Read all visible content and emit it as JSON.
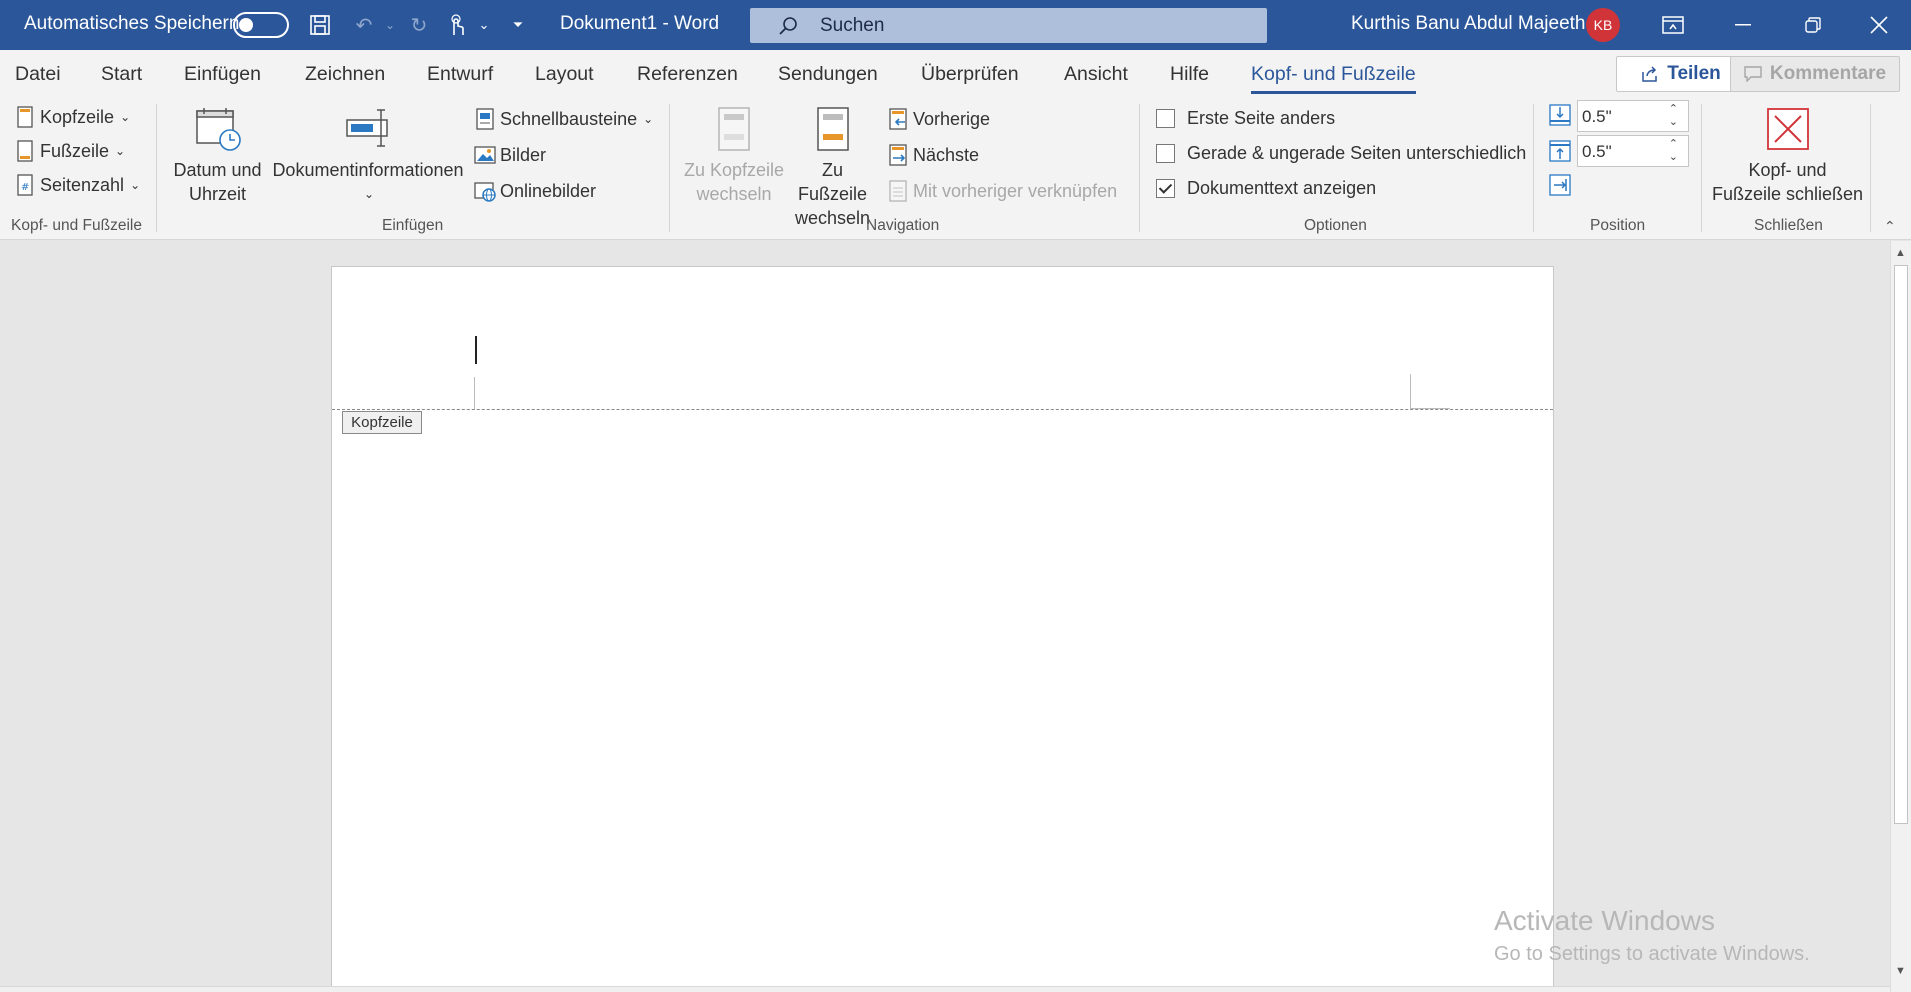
{
  "titlebar": {
    "autosave_label": "Automatisches Speichern",
    "doc_title": "Dokument1  -  Word",
    "search_placeholder": "Suchen",
    "user_name": "Kurthis Banu Abdul Majeeth",
    "user_initials": "KB"
  },
  "tabs": [
    "Datei",
    "Start",
    "Einfügen",
    "Zeichnen",
    "Entwurf",
    "Layout",
    "Referenzen",
    "Sendungen",
    "Überprüfen",
    "Ansicht",
    "Hilfe",
    "Kopf- und Fußzeile"
  ],
  "active_tab": "Kopf- und Fußzeile",
  "share_label": "Teilen",
  "comments_label": "Kommentare",
  "ribbon": {
    "group_kopf": {
      "label": "Kopf- und Fußzeile",
      "kopfzeile": "Kopfzeile",
      "fusszeile": "Fußzeile",
      "seitenzahl": "Seitenzahl"
    },
    "group_einfuegen": {
      "label": "Einfügen",
      "datum_line1": "Datum und",
      "datum_line2": "Uhrzeit",
      "dokinfo": "Dokumentinformationen",
      "schnellbausteine": "Schnellbausteine",
      "bilder": "Bilder",
      "onlinebilder": "Onlinebilder"
    },
    "group_navigation": {
      "label": "Navigation",
      "zu_kopf_line1": "Zu Kopfzeile",
      "zu_kopf_line2": "wechseln",
      "zu_fuss_line1": "Zu Fußzeile",
      "zu_fuss_line2": "wechseln",
      "vorherige": "Vorherige",
      "naechste": "Nächste",
      "verknuepfen": "Mit vorheriger verknüpfen"
    },
    "group_optionen": {
      "label": "Optionen",
      "erste_seite": "Erste Seite anders",
      "erste_seite_checked": false,
      "gerade_ungerade": "Gerade & ungerade Seiten unterschiedlich",
      "gerade_ungerade_checked": false,
      "dokumenttext": "Dokumenttext anzeigen",
      "dokumenttext_checked": true
    },
    "group_position": {
      "label": "Position",
      "header_from_top": "0.5\"",
      "footer_from_bottom": "0.5\""
    },
    "group_schliessen": {
      "label": "Schließen",
      "close_line1": "Kopf- und",
      "close_line2": "Fußzeile schließen"
    }
  },
  "document": {
    "header_tag": "Kopfzeile"
  },
  "watermark": {
    "line1": "Activate Windows",
    "line2": "Go to Settings to activate Windows."
  },
  "colors": {
    "accent": "#2b579a",
    "avatar": "#d13438"
  }
}
